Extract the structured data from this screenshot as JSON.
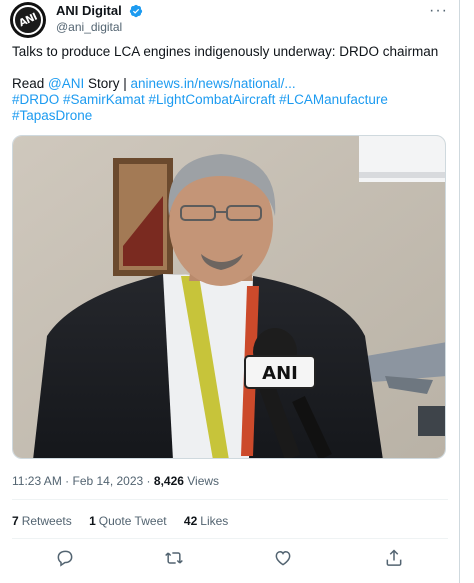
{
  "author": {
    "display_name": "ANI Digital",
    "handle": "@ani_digital",
    "avatar_text": "ANI"
  },
  "tweet": {
    "headline": "Talks to produce LCA engines indigenously underway: DRDO chairman",
    "read_prefix": "Read ",
    "mention": "@ANI",
    "story_text": " Story | ",
    "url": "aninews.in/news/national/...",
    "hashtags_line1": "#DRDO #SamirKamat #LightCombatAircraft #LCAManufacture",
    "hashtags_line2": "#TapasDrone"
  },
  "media": {
    "mic_label": "ANI"
  },
  "meta": {
    "time": "11:23 AM",
    "separator": " · ",
    "date": "Feb 14, 2023",
    "views_count": "8,426",
    "views_label": " Views"
  },
  "stats": {
    "retweets_count": "7",
    "retweets_label": "Retweets",
    "quotes_count": "1",
    "quotes_label": "Quote Tweet",
    "likes_count": "42",
    "likes_label": "Likes"
  },
  "icons": {
    "verified": "verified-badge-icon",
    "more": "more-icon",
    "reply": "reply-icon",
    "retweet": "retweet-icon",
    "like": "like-icon",
    "share": "share-icon"
  },
  "colors": {
    "link": "#1d9bf0",
    "muted": "#536471",
    "text": "#0f1419"
  }
}
